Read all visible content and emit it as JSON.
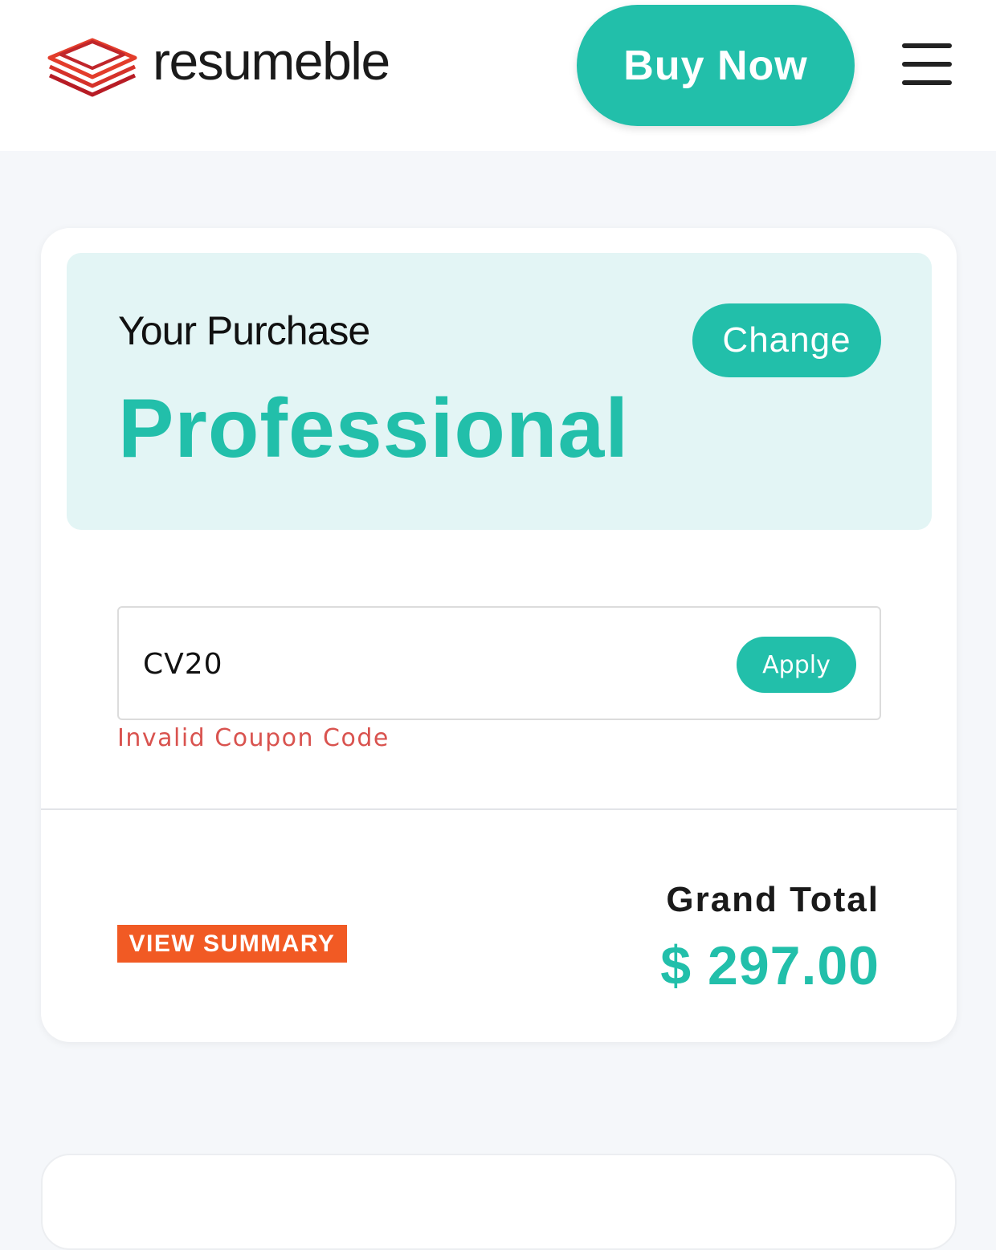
{
  "header": {
    "logo_text": "resumeble",
    "buy_label": "Buy Now"
  },
  "purchase": {
    "label": "Your Purchase",
    "plan": "Professional",
    "change_label": "Change"
  },
  "coupon": {
    "value": "CV20",
    "apply_label": "Apply",
    "error": "Invalid Coupon Code"
  },
  "summary": {
    "view_label": "VIEW SUMMARY",
    "total_label": "Grand Total",
    "total_value": "$ 297.00"
  },
  "colors": {
    "accent": "#22bfaa",
    "logo_red": "#c62828",
    "summary_orange": "#f15a24",
    "error_red": "#d9534f"
  },
  "icons": {
    "logo": "stacked-layers-logo-icon",
    "menu": "hamburger-menu-icon"
  }
}
